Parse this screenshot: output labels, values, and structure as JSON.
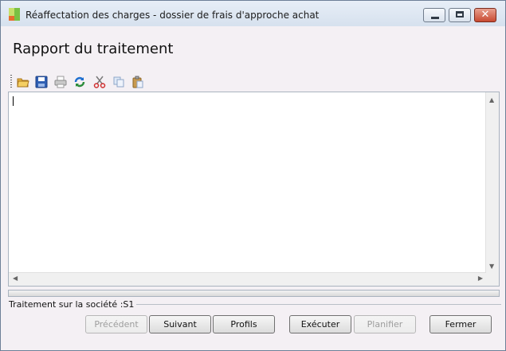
{
  "window": {
    "title": "Réaffectation des charges - dossier de frais d'approche achat"
  },
  "report": {
    "title": "Rapport du traitement",
    "content": ""
  },
  "toolbar": {
    "icons": [
      "folder-open-icon",
      "save-icon",
      "print-icon",
      "refresh-icon",
      "cut-icon",
      "copy-icon",
      "paste-icon"
    ]
  },
  "progress": {
    "value": 0
  },
  "status": {
    "text": "Traitement sur la société :S1"
  },
  "buttons": {
    "previous": "Précédent",
    "next": "Suivant",
    "profiles": "Profils",
    "execute": "Exécuter",
    "schedule": "Planifier",
    "close": "Fermer"
  }
}
